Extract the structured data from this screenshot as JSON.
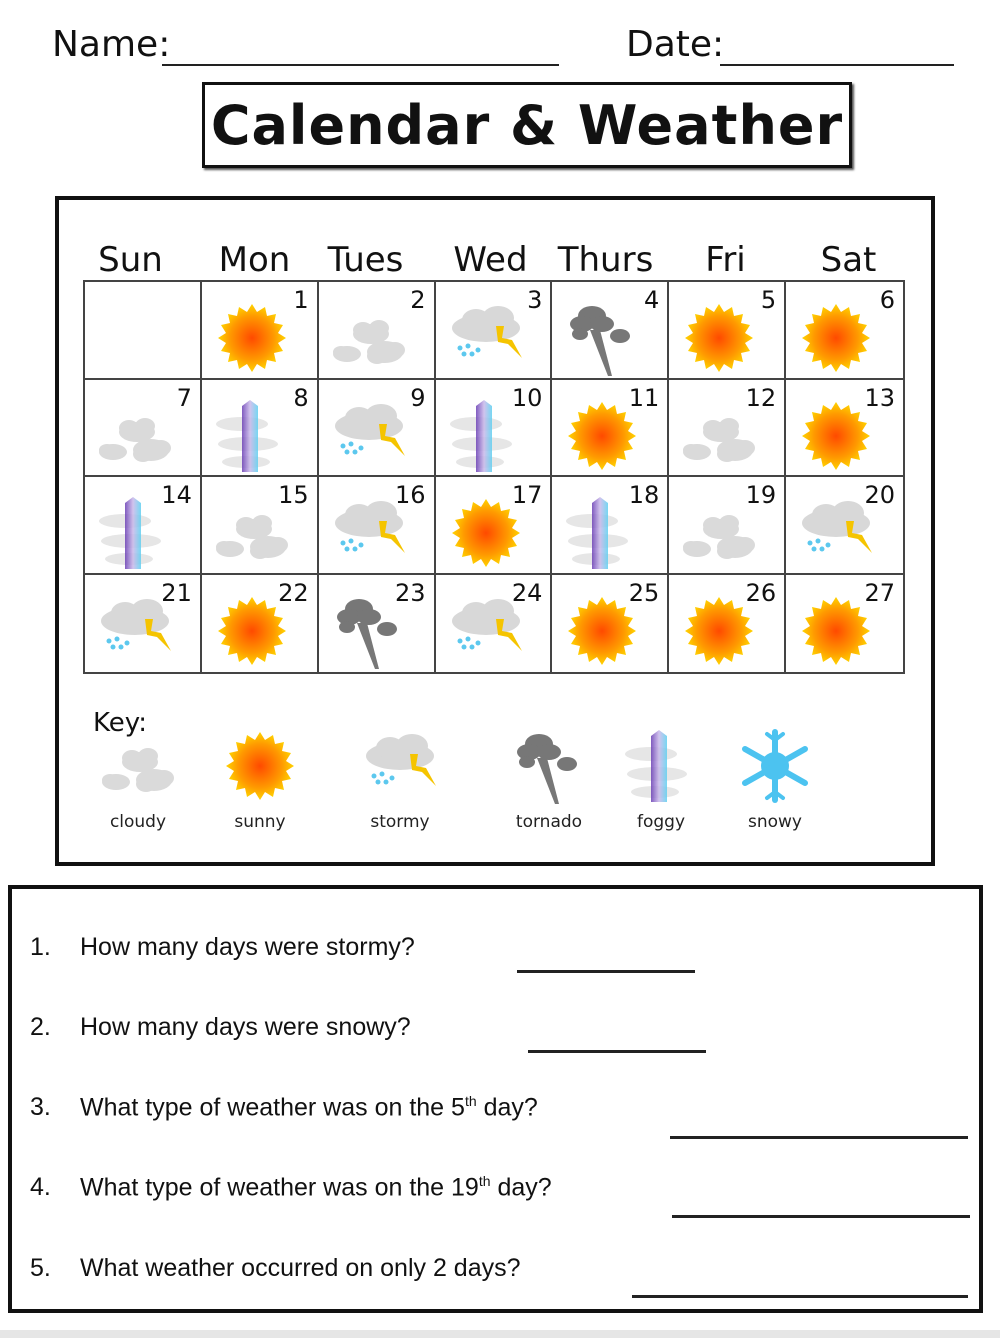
{
  "header": {
    "name_label": "Name:",
    "date_label": "Date:"
  },
  "title": "Calendar & Weather",
  "calendar": {
    "day_headers": [
      "Sun",
      "Mon",
      "Tues",
      "Wed",
      "Thurs",
      "Fri",
      "Sat"
    ],
    "cells": [
      {
        "day": "",
        "weather": "none"
      },
      {
        "day": "1",
        "weather": "sunny"
      },
      {
        "day": "2",
        "weather": "cloudy"
      },
      {
        "day": "3",
        "weather": "stormy"
      },
      {
        "day": "4",
        "weather": "tornado"
      },
      {
        "day": "5",
        "weather": "sunny"
      },
      {
        "day": "6",
        "weather": "sunny"
      },
      {
        "day": "7",
        "weather": "cloudy"
      },
      {
        "day": "8",
        "weather": "foggy"
      },
      {
        "day": "9",
        "weather": "stormy"
      },
      {
        "day": "10",
        "weather": "foggy"
      },
      {
        "day": "11",
        "weather": "sunny"
      },
      {
        "day": "12",
        "weather": "cloudy"
      },
      {
        "day": "13",
        "weather": "sunny"
      },
      {
        "day": "14",
        "weather": "foggy"
      },
      {
        "day": "15",
        "weather": "cloudy"
      },
      {
        "day": "16",
        "weather": "stormy"
      },
      {
        "day": "17",
        "weather": "sunny"
      },
      {
        "day": "18",
        "weather": "foggy"
      },
      {
        "day": "19",
        "weather": "cloudy"
      },
      {
        "day": "20",
        "weather": "stormy"
      },
      {
        "day": "21",
        "weather": "stormy"
      },
      {
        "day": "22",
        "weather": "sunny"
      },
      {
        "day": "23",
        "weather": "tornado"
      },
      {
        "day": "24",
        "weather": "stormy"
      },
      {
        "day": "25",
        "weather": "sunny"
      },
      {
        "day": "26",
        "weather": "sunny"
      },
      {
        "day": "27",
        "weather": "sunny"
      }
    ]
  },
  "key": {
    "label": "Key:",
    "items": [
      {
        "weather": "cloudy",
        "caption": "cloudy"
      },
      {
        "weather": "sunny",
        "caption": "sunny"
      },
      {
        "weather": "stormy",
        "caption": "stormy"
      },
      {
        "weather": "tornado",
        "caption": "tornado"
      },
      {
        "weather": "foggy",
        "caption": "foggy"
      },
      {
        "weather": "snowy",
        "caption": "snowy"
      }
    ]
  },
  "colors": {
    "sun_center": "#ff5a00",
    "sun_edge": "#ffd000",
    "cloud": "#dcdcdc",
    "tornado": "#7a7a7a",
    "bolt": "#f5c400",
    "rain": "#5cc8ee",
    "snow": "#4cc3f0",
    "fog_purple": "#6a3fb5",
    "fog_blue": "#5fd0f0"
  },
  "questions": [
    {
      "num": "1.",
      "text": "How many days were stormy?",
      "answer": ""
    },
    {
      "num": "2.",
      "text": "How many days were snowy?",
      "answer": ""
    },
    {
      "num": "3.",
      "text_before": "What type of weather was on the 5",
      "sup": "th",
      "text_after": " day?",
      "answer": ""
    },
    {
      "num": "4.",
      "text_before": "What type of weather was on the 19",
      "sup": "th",
      "text_after": " day?",
      "answer": ""
    },
    {
      "num": "5.",
      "text": "What weather occurred on only 2 days?",
      "answer": ""
    }
  ]
}
